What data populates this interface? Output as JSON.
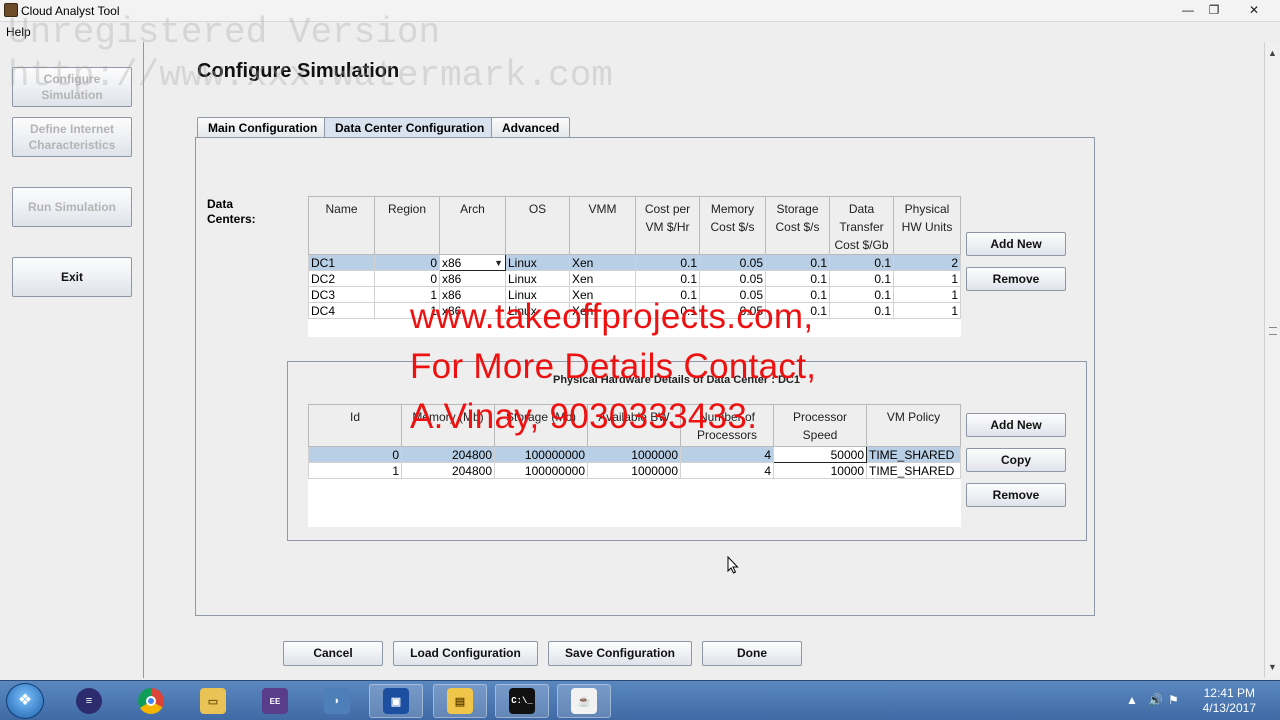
{
  "window": {
    "title": "Cloud Analyst Tool",
    "minimize": "—",
    "maximize": "❐",
    "close": "✕"
  },
  "menu": {
    "help": "Help"
  },
  "sidebar": {
    "config_sim": "Configure Simulation",
    "define_internet": "Define Internet Characteristics",
    "run_sim": "Run Simulation",
    "exit": "Exit"
  },
  "page": {
    "heading": "Configure Simulation"
  },
  "tabs": [
    "Main Configuration",
    "Data Center Configuration",
    "Advanced"
  ],
  "datacenters": {
    "label": "Data Centers:",
    "columns": [
      "Name",
      "Region",
      "Arch",
      "OS",
      "VMM",
      "Cost per VM $/Hr",
      "Memory Cost $/s",
      "Storage Cost $/s",
      "Data Transfer Cost $/Gb",
      "Physical HW Units"
    ],
    "rows": [
      [
        "DC1",
        "0",
        "x86",
        "Linux",
        "Xen",
        "0.1",
        "0.05",
        "0.1",
        "0.1",
        "2"
      ],
      [
        "DC2",
        "0",
        "x86",
        "Linux",
        "Xen",
        "0.1",
        "0.05",
        "0.1",
        "0.1",
        "1"
      ],
      [
        "DC3",
        "1",
        "x86",
        "Linux",
        "Xen",
        "0.1",
        "0.05",
        "0.1",
        "0.1",
        "1"
      ],
      [
        "DC4",
        "1",
        "x86",
        "Linux",
        "Xen",
        "0.1",
        "0.05",
        "0.1",
        "0.1",
        "1"
      ]
    ],
    "add_new": "Add New",
    "remove": "Remove"
  },
  "hardware": {
    "title": "Physical Hardware Details of Data Center : DC1",
    "columns": [
      "Id",
      "Memory (Mb)",
      "Storage (Mb)",
      "Available BW",
      "Number of Processors",
      "Processor Speed",
      "VM Policy"
    ],
    "rows": [
      [
        "0",
        "204800",
        "100000000",
        "1000000",
        "4",
        "50000",
        "TIME_SHARED"
      ],
      [
        "1",
        "204800",
        "100000000",
        "1000000",
        "4",
        "10000",
        "TIME_SHARED"
      ]
    ],
    "add_new": "Add New",
    "copy": "Copy",
    "remove": "Remove"
  },
  "footer": {
    "cancel": "Cancel",
    "load": "Load Configuration",
    "save": "Save Configuration",
    "done": "Done"
  },
  "overlay": {
    "line1": "www.takeoffprojects.com,",
    "line2": "For More Details Contact,",
    "line3": "A.Vinay, 9030333433.",
    "color": "#ee1111"
  },
  "watermark": {
    "line1": "Unregistered Version",
    "line2": "http://www.xxx.watermark.com"
  },
  "taskbar": {
    "icons": [
      "windows-start-icon",
      "eclipse-icon",
      "chrome-icon",
      "folder-icon",
      "java-ee-ide-icon",
      "dolphin-icon",
      "virtualbox-icon",
      "file-explorer-icon",
      "command-prompt-icon",
      "java-icon"
    ],
    "time": "12:41 PM",
    "date": "4/13/2017"
  }
}
